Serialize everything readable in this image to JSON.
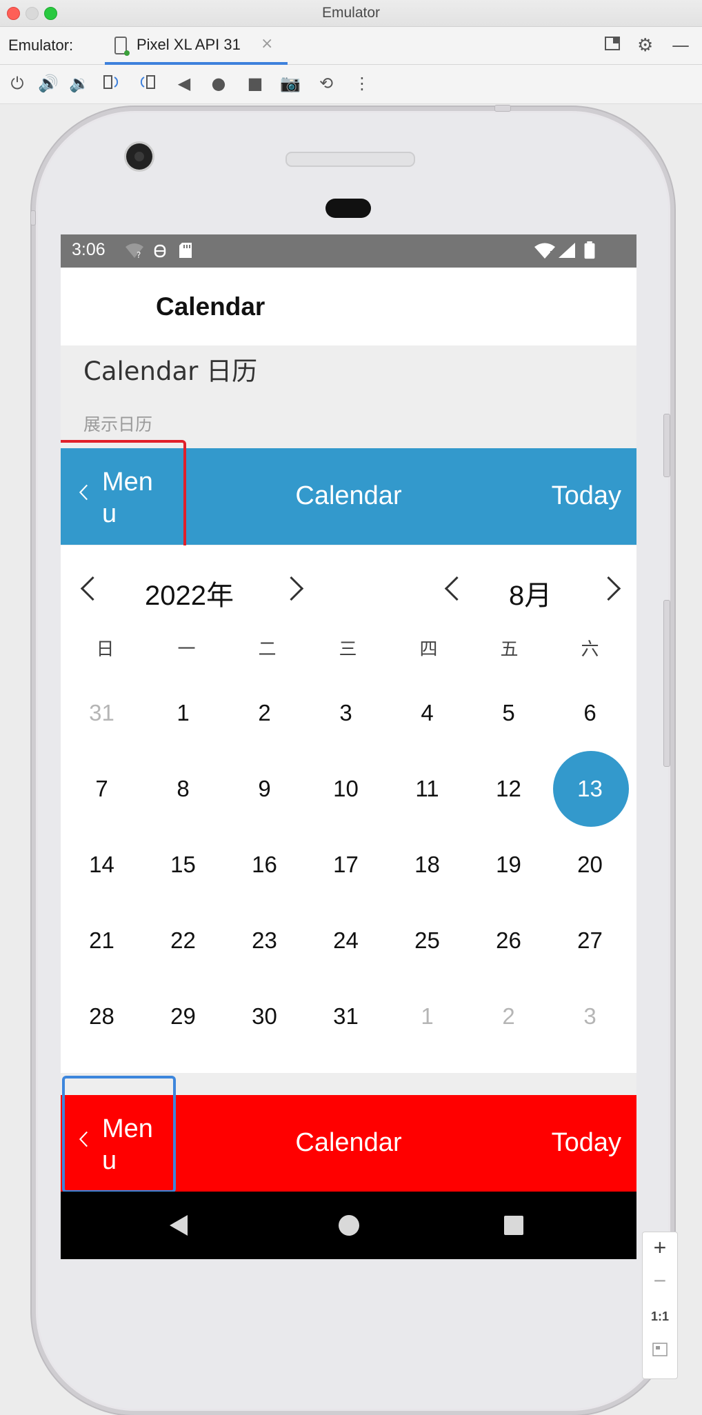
{
  "window": {
    "title": "Emulator"
  },
  "tabbar": {
    "label": "Emulator:",
    "tab": "Pixel XL API 31",
    "close": "×"
  },
  "toolbar": {
    "icons": [
      "power-icon",
      "volume-up-icon",
      "volume-down-icon",
      "rotate-left-icon",
      "rotate-right-icon",
      "back-icon",
      "home-icon",
      "overview-icon",
      "camera-icon",
      "reset-icon",
      "more-icon"
    ]
  },
  "status": {
    "time": "3:06"
  },
  "appbar": {
    "title": "Calendar"
  },
  "section": {
    "title": "Calendar 日历",
    "subtitle": "展示日历"
  },
  "nav_blue": {
    "back": "Menu",
    "title": "Calendar",
    "right": "Today",
    "color": "#3399cc",
    "highlight": "#e0202a"
  },
  "nav_red": {
    "back": "Menu",
    "title": "Calendar",
    "right": "Today",
    "color": "#ff0000",
    "highlight": "#3d86dc"
  },
  "calendar": {
    "year": "2022年",
    "month": "8月",
    "weekdays": [
      "日",
      "一",
      "二",
      "三",
      "四",
      "五",
      "六"
    ],
    "selected": "13",
    "selected_color": "#3399cc",
    "rows": [
      [
        {
          "d": "31",
          "out": true
        },
        {
          "d": "1"
        },
        {
          "d": "2"
        },
        {
          "d": "3"
        },
        {
          "d": "4"
        },
        {
          "d": "5"
        },
        {
          "d": "6"
        }
      ],
      [
        {
          "d": "7"
        },
        {
          "d": "8"
        },
        {
          "d": "9"
        },
        {
          "d": "10"
        },
        {
          "d": "11"
        },
        {
          "d": "12"
        },
        {
          "d": "13",
          "sel": true
        }
      ],
      [
        {
          "d": "14"
        },
        {
          "d": "15"
        },
        {
          "d": "16"
        },
        {
          "d": "17"
        },
        {
          "d": "18"
        },
        {
          "d": "19"
        },
        {
          "d": "20"
        }
      ],
      [
        {
          "d": "21"
        },
        {
          "d": "22"
        },
        {
          "d": "23"
        },
        {
          "d": "24"
        },
        {
          "d": "25"
        },
        {
          "d": "26"
        },
        {
          "d": "27"
        }
      ],
      [
        {
          "d": "28"
        },
        {
          "d": "29"
        },
        {
          "d": "30"
        },
        {
          "d": "31"
        },
        {
          "d": "1",
          "out": true
        },
        {
          "d": "2",
          "out": true
        },
        {
          "d": "3",
          "out": true
        }
      ]
    ]
  },
  "zoom": {
    "plus": "+",
    "minus": "−",
    "ratio": "1:1"
  }
}
